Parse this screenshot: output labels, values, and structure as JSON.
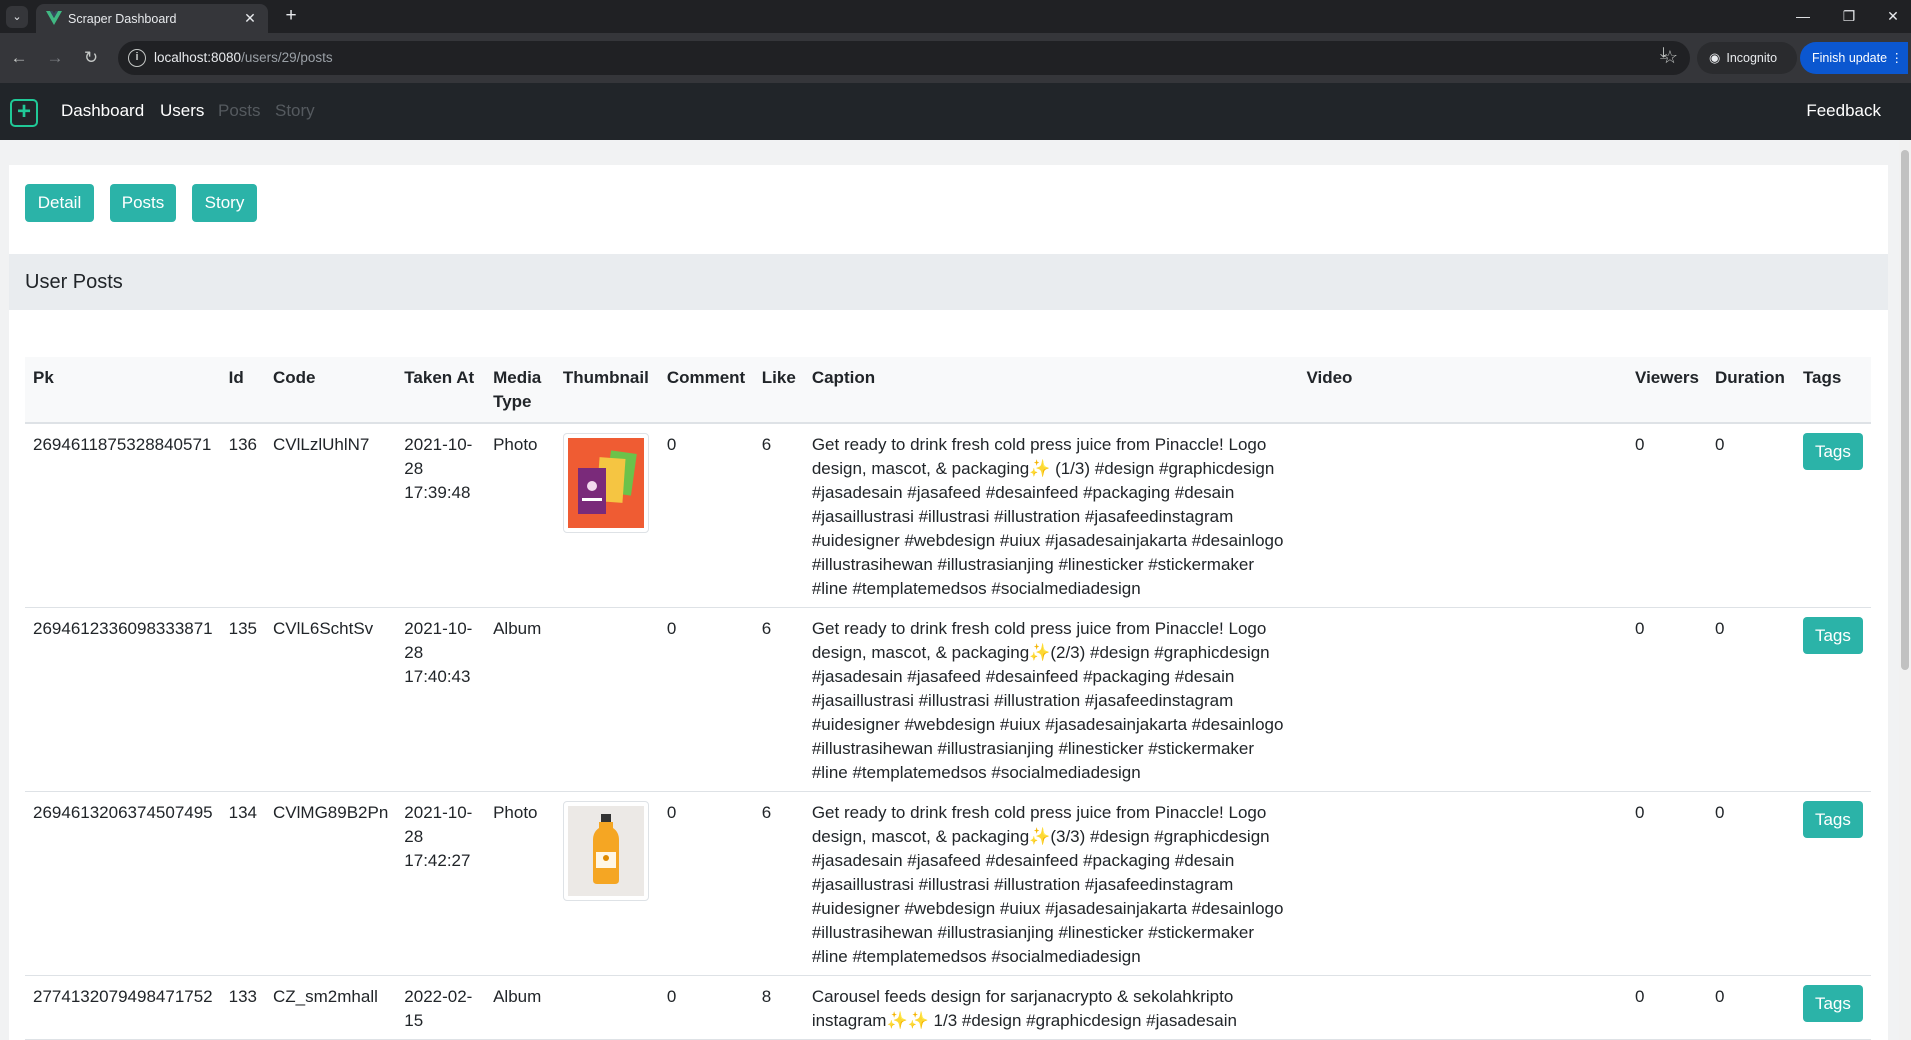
{
  "browser": {
    "tab_title": "Scraper Dashboard",
    "url_host": "localhost:8080",
    "url_path": "/users/29/posts",
    "incognito_label": "Incognito",
    "finish_update_label": "Finish update"
  },
  "navbar": {
    "links": [
      "Dashboard",
      "Users",
      "Posts",
      "Story"
    ],
    "feedback": "Feedback"
  },
  "buttons": {
    "detail": "Detail",
    "posts": "Posts",
    "story": "Story"
  },
  "section": {
    "title": "User Posts"
  },
  "table": {
    "headers": [
      "Pk",
      "Id",
      "Code",
      "Taken At",
      "Media Type",
      "Thumbnail",
      "Comment",
      "Like",
      "Caption",
      "Video",
      "Viewers",
      "Duration",
      "Tags"
    ],
    "rows": [
      {
        "pk": "2694611875328840571",
        "id": "136",
        "code": "CVlLzlUhlN7",
        "taken_at": "2021-10-28 17:39:48",
        "media_type": "Photo",
        "thumbnail": "orange",
        "comment": "0",
        "like": "6",
        "caption": "Get ready to drink fresh cold press juice from Pinaccle! Logo design, mascot, & packaging✨ (1/3) #design #graphicdesign #jasadesain #jasafeed #desainfeed #packaging #desain #jasaillustrasi #illustrasi #illustration #jasafeedinstagram #uidesigner #webdesign #uiux #jasadesainjakarta #desainlogo #illustrasihewan #illustrasianjing #linesticker #stickermaker #line #templatemedsos #socialmediadesign",
        "video": "",
        "viewers": "0",
        "duration": "0",
        "tags": "Tags"
      },
      {
        "pk": "2694612336098333871",
        "id": "135",
        "code": "CVlL6SchtSv",
        "taken_at": "2021-10-28 17:40:43",
        "media_type": "Album",
        "thumbnail": "",
        "comment": "0",
        "like": "6",
        "caption": "Get ready to drink fresh cold press juice from Pinaccle! Logo design, mascot, & packaging✨(2/3) #design #graphicdesign #jasadesain #jasafeed #desainfeed #packaging #desain #jasaillustrasi #illustrasi #illustration #jasafeedinstagram #uidesigner #webdesign #uiux #jasadesainjakarta #desainlogo #illustrasihewan #illustrasianjing #linesticker #stickermaker #line #templatemedsos #socialmediadesign",
        "video": "",
        "viewers": "0",
        "duration": "0",
        "tags": "Tags"
      },
      {
        "pk": "2694613206374507495",
        "id": "134",
        "code": "CVlMG89B2Pn",
        "taken_at": "2021-10-28 17:42:27",
        "media_type": "Photo",
        "thumbnail": "bottle",
        "comment": "0",
        "like": "6",
        "caption": "Get ready to drink fresh cold press juice from Pinaccle! Logo design, mascot, & packaging✨(3/3) #design #graphicdesign #jasadesain #jasafeed #desainfeed #packaging #desain #jasaillustrasi #illustrasi #illustration #jasafeedinstagram #uidesigner #webdesign #uiux #jasadesainjakarta #desainlogo #illustrasihewan #illustrasianjing #linesticker #stickermaker #line #templatemedsos #socialmediadesign",
        "video": "",
        "viewers": "0",
        "duration": "0",
        "tags": "Tags"
      },
      {
        "pk": "2774132079498471752",
        "id": "133",
        "code": "CZ_sm2mhall",
        "taken_at": "2022-02-15",
        "media_type": "Album",
        "thumbnail": "",
        "comment": "0",
        "like": "8",
        "caption": "Carousel feeds design for sarjanacrypto & sekolahkripto instagram✨✨ 1/3 #design #graphicdesign #jasadesain",
        "video": "",
        "viewers": "0",
        "duration": "0",
        "tags": "Tags"
      }
    ]
  }
}
